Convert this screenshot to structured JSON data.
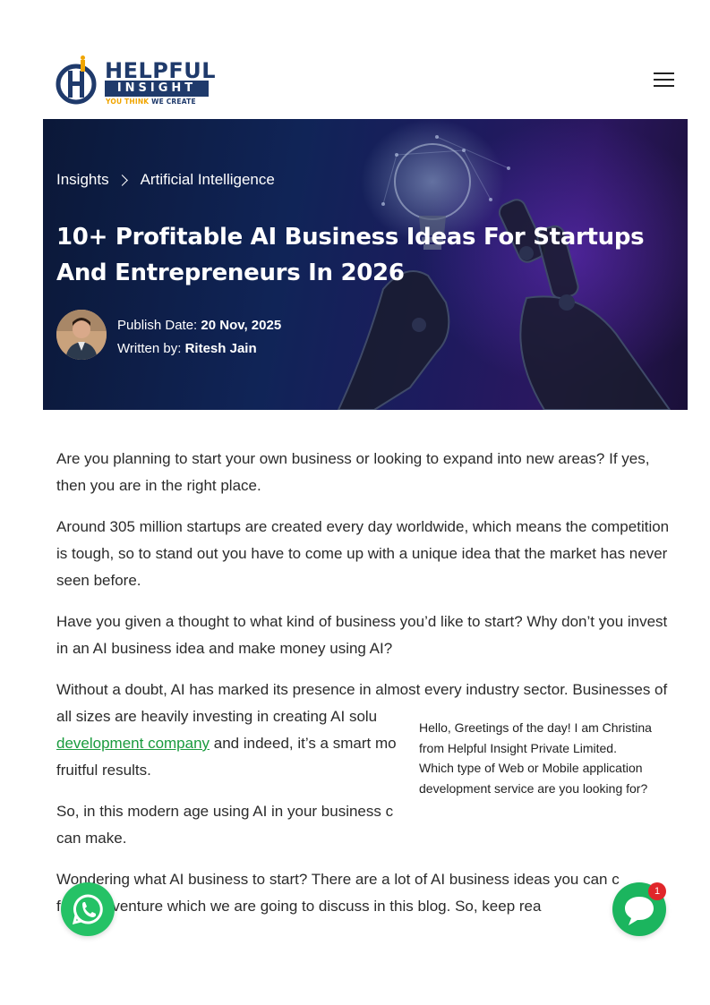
{
  "brand": {
    "logo_word": "HELPFUL",
    "logo_sub": "INSIGHT",
    "tagline_a": "YOU THINK",
    "tagline_b": "WE CREATE",
    "colors": {
      "navy": "#1f3a6b",
      "orange": "#f0a500",
      "link_green": "#1a9b3e"
    }
  },
  "header": {
    "menu_icon": "hamburger-icon"
  },
  "breadcrumb": {
    "items": [
      "Insights",
      "Artificial Intelligence"
    ]
  },
  "hero": {
    "title": "10+ Profitable AI Business Ideas For Startups And Entrepreneurs In 2026",
    "publish_label": "Publish Date:",
    "publish_date": "20 Nov, 2025",
    "author_label": "Written by:",
    "author": "Ritesh Jain"
  },
  "article": {
    "p1": "Are you planning to start your own business or looking to expand into new areas? If yes, then you are in the right place.",
    "p2": "Around 305 million startups are created every day worldwide, which means the competition is tough, so to stand out you have to come up with a unique idea that the market has never seen before.",
    "p3": "Have you given a thought to what kind of business you’d like to start? Why don’t you invest in an AI business idea and make money using AI?",
    "p4_start": "Without a doubt, AI has marked its presence in almost every industry sector. Businesses of all sizes are heavily investing in creating AI solu",
    "p4_link": "development company",
    "p4_end": " and indeed, it’s a smart mo",
    "p4_tail": "fruitful results.",
    "p5": "So, in this modern age using AI in your business c",
    "p5_tail": "can make.",
    "p6": "Wondering what AI business to start? There are a lot of AI business ideas you can c",
    "p6_tail": "  for your venture which we are going to discuss in this blog. So, keep rea"
  },
  "chat": {
    "line1": "Hello, Greetings of the day! I am Christina from Helpful Insight Private Limited.",
    "line2": "Which type of Web or Mobile application development service are you looking for?",
    "badge": "1"
  }
}
